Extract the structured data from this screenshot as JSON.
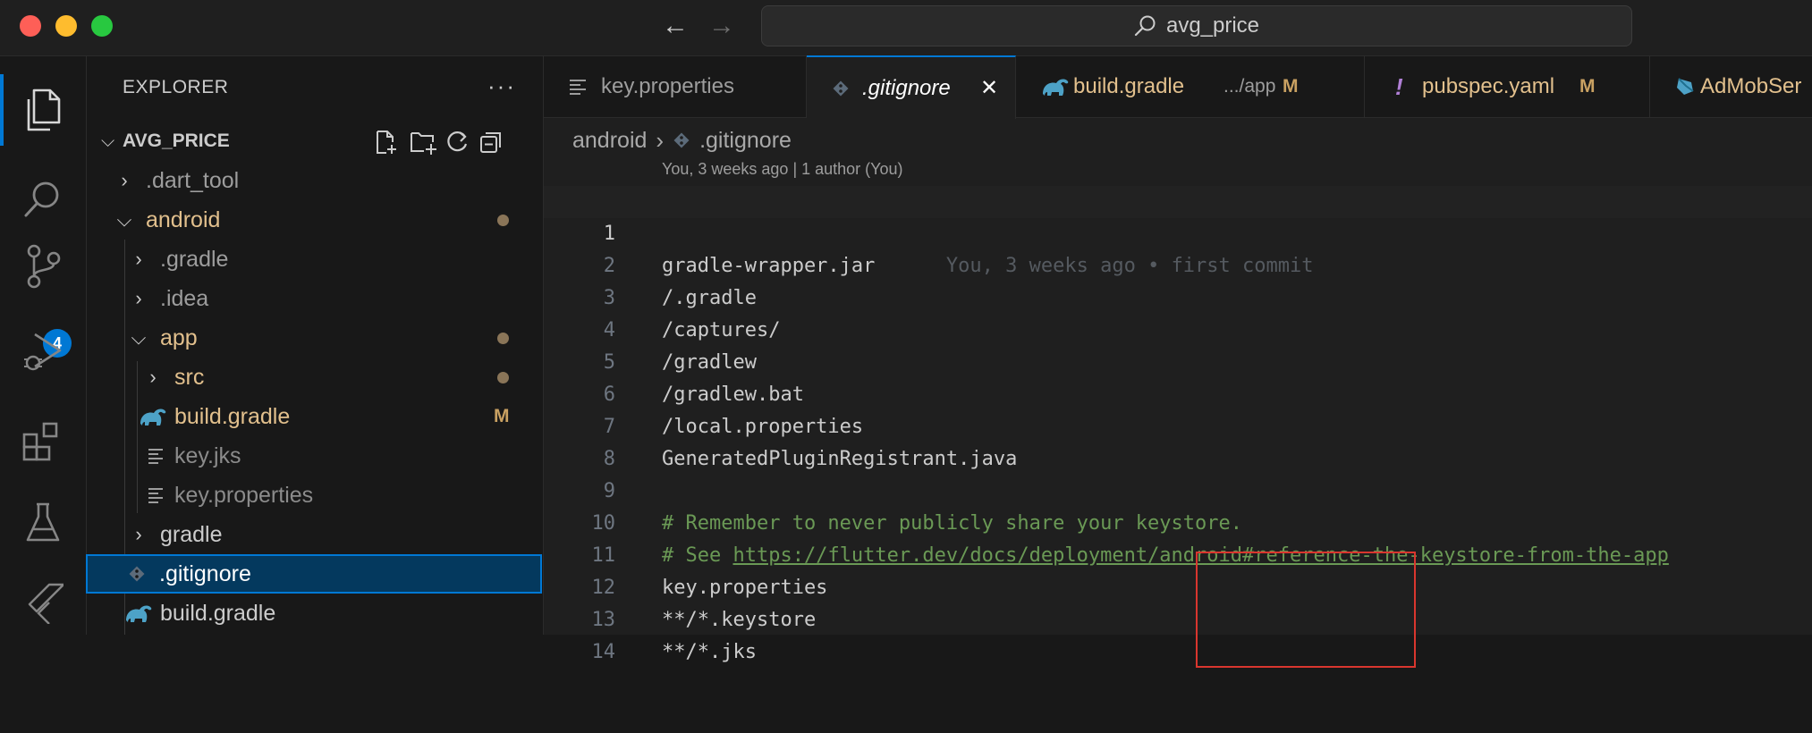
{
  "titlebar": {
    "back_label": "←",
    "forward_label": "→",
    "search_text": "avg_price"
  },
  "activity": {
    "scm_badge": "4"
  },
  "explorer": {
    "title": "EXPLORER",
    "more_label": "···",
    "project_name": "AVG_PRICE",
    "tree": [
      {
        "label": ".dart_tool",
        "color": "#9d9d9d",
        "kind": "folder"
      },
      {
        "label": "android",
        "color": "#e2c08d",
        "kind": "folder-open"
      },
      {
        "label": ".gradle",
        "color": "#9d9d9d",
        "kind": "folder"
      },
      {
        "label": ".idea",
        "color": "#9d9d9d",
        "kind": "folder"
      },
      {
        "label": "app",
        "color": "#e2c08d",
        "kind": "folder-open"
      },
      {
        "label": "src",
        "color": "#e2c08d",
        "kind": "folder"
      },
      {
        "label": "build.gradle",
        "color": "#e2c08d",
        "kind": "gradle",
        "status": "M"
      },
      {
        "label": "key.jks",
        "color": "#8b8b8b",
        "kind": "text"
      },
      {
        "label": "key.properties",
        "color": "#8b8b8b",
        "kind": "text"
      },
      {
        "label": "gradle",
        "color": "#cccccc",
        "kind": "folder"
      },
      {
        "label": ".gitignore",
        "color": "#cccccc",
        "kind": "git"
      },
      {
        "label": "build.gradle",
        "color": "#cccccc",
        "kind": "gradle"
      }
    ]
  },
  "tabs": [
    {
      "label": "key.properties"
    },
    {
      "label": ".gitignore",
      "close": "✕"
    },
    {
      "label": "build.gradle",
      "extra": ".../app",
      "status": "M"
    },
    {
      "label": "pubspec.yaml",
      "status": "M"
    },
    {
      "label": "AdMobSer"
    }
  ],
  "breadcrumb": {
    "folder": "android",
    "file": ".gitignore"
  },
  "blame": {
    "header": "You, 3 weeks ago | 1 author (You)",
    "inline": "You, 3 weeks ago • first commit"
  },
  "code": {
    "lines": [
      {
        "n": "1",
        "text": "gradle-wrapper.jar"
      },
      {
        "n": "2",
        "text": "/.gradle"
      },
      {
        "n": "3",
        "text": "/captures/"
      },
      {
        "n": "4",
        "text": "/gradlew"
      },
      {
        "n": "5",
        "text": "/gradlew.bat"
      },
      {
        "n": "6",
        "text": "/local.properties"
      },
      {
        "n": "7",
        "text": "GeneratedPluginRegistrant.java"
      },
      {
        "n": "8",
        "text": ""
      },
      {
        "n": "9",
        "text": "# Remember to never publicly share your keystore."
      },
      {
        "n": "10",
        "text": "# See ",
        "link": "https://flutter.dev/docs/deployment/android#reference-the-keystore-from-the-app"
      },
      {
        "n": "11",
        "text": "key.properties"
      },
      {
        "n": "12",
        "text": "**/*.keystore"
      },
      {
        "n": "13",
        "text": "**/*.jks"
      },
      {
        "n": "14",
        "text": ""
      }
    ]
  },
  "colors": {
    "accent": "#0078d4",
    "modified": "#e2c08d",
    "comment": "#6a9955",
    "highlight": "#d9362e"
  }
}
